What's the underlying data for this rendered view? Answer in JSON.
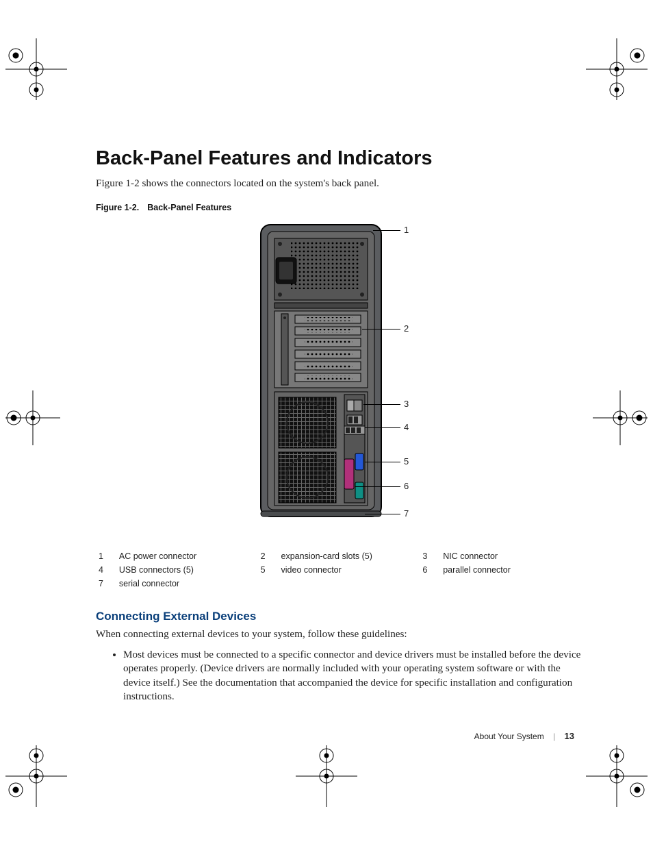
{
  "heading": "Back-Panel Features and Indicators",
  "intro": "Figure 1-2 shows the connectors located on the system's back panel.",
  "figure_caption_prefix": "Figure 1-2.",
  "figure_caption_title": "Back-Panel Features",
  "callouts": [
    "1",
    "2",
    "3",
    "4",
    "5",
    "6",
    "7"
  ],
  "legend": [
    {
      "n": "1",
      "t": "AC power connector"
    },
    {
      "n": "2",
      "t": "expansion-card slots (5)"
    },
    {
      "n": "3",
      "t": "NIC connector"
    },
    {
      "n": "4",
      "t": "USB connectors (5)"
    },
    {
      "n": "5",
      "t": "video connector"
    },
    {
      "n": "6",
      "t": "parallel connector"
    },
    {
      "n": "7",
      "t": "serial connector"
    }
  ],
  "subhead": "Connecting External Devices",
  "body": "When connecting external devices to your system, follow these guidelines:",
  "bullet1": "Most devices must be connected to a specific connector and device drivers must be installed before the device operates properly. (Device drivers are normally included with your operating system software or with the device itself.) See the documentation that accompanied the device for specific installation and configuration instructions.",
  "footer_section": "About Your System",
  "footer_page": "13"
}
